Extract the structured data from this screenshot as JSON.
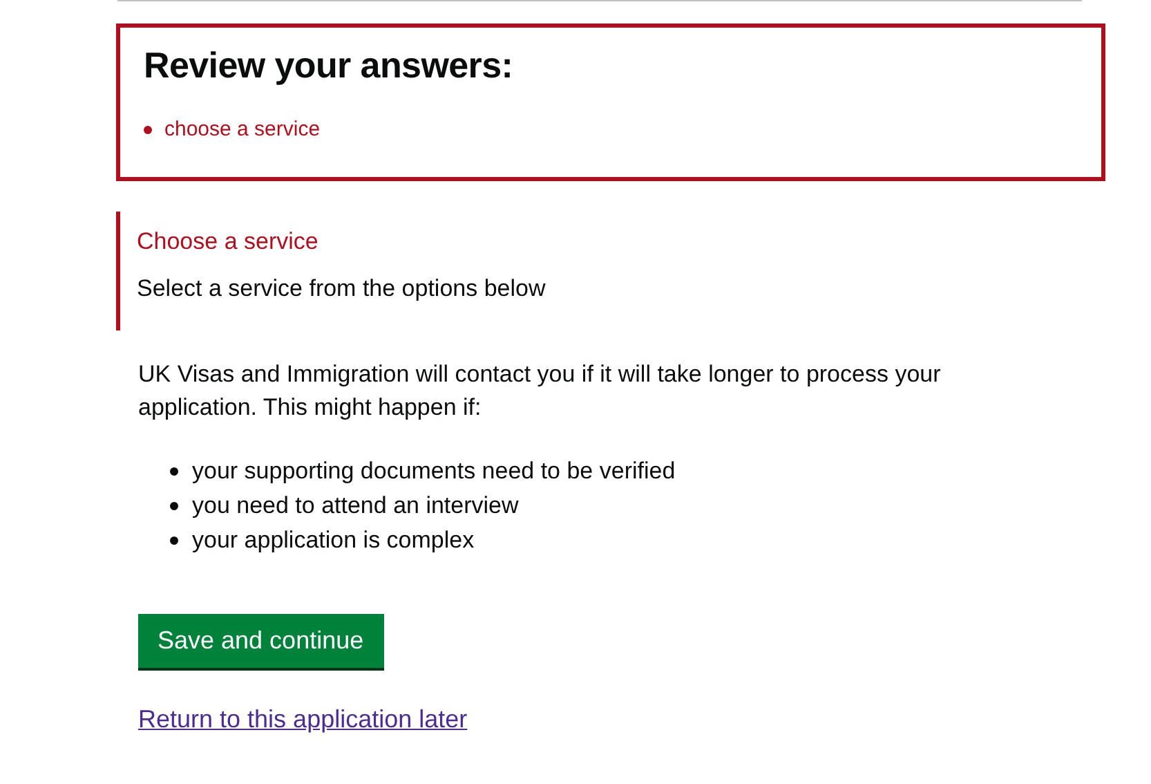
{
  "error_summary": {
    "title": "Review your answers:",
    "errors": [
      "choose a service"
    ]
  },
  "field_error": {
    "label": "Choose a service",
    "hint": "Select a service from the options below"
  },
  "paragraph": "UK Visas and Immigration will contact you if it will take longer to process your application. This might happen if:",
  "reasons": [
    "your supporting documents need to be verified",
    "you need to attend an interview",
    "your application is complex"
  ],
  "primary_button": "Save and continue",
  "return_link": "Return to this application later"
}
